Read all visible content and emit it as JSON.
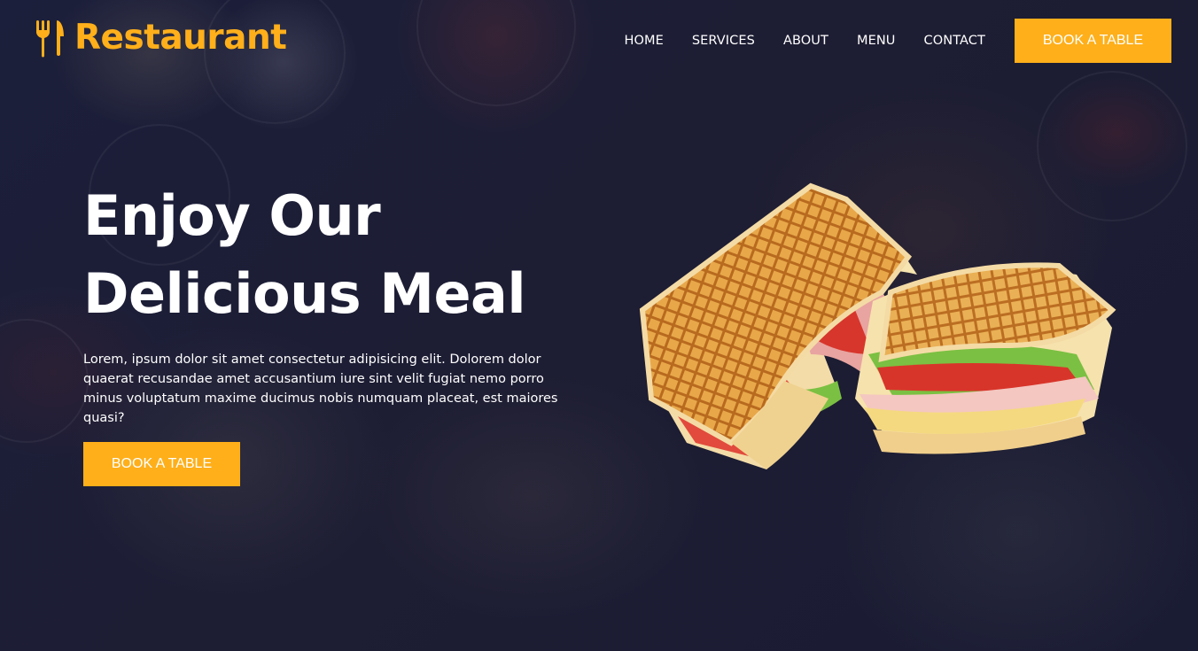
{
  "brand": {
    "name": "Restaurant",
    "icon": "fork-knife-icon",
    "accent_color": "#feaf1a"
  },
  "nav": {
    "items": [
      "HOME",
      "SERVICES",
      "ABOUT",
      "MENU",
      "CONTACT"
    ]
  },
  "header": {
    "cta_label": "BOOK A TABLE"
  },
  "hero": {
    "title_line1": "Enjoy Our",
    "title_line2": "Delicious Meal",
    "description": "Lorem, ipsum dolor sit amet consectetur adipisicing elit. Dolorem dolor quaerat recusandae amet accusantium iure sint velit fugiat nemo porro minus voluptatum maxime ducimus nobis numquam placeat, est maiores quasi?",
    "cta_label": "BOOK A TABLE",
    "image": "grilled-sandwich-image"
  },
  "colors": {
    "background": "#1c1f3b",
    "text": "#ffffff"
  }
}
